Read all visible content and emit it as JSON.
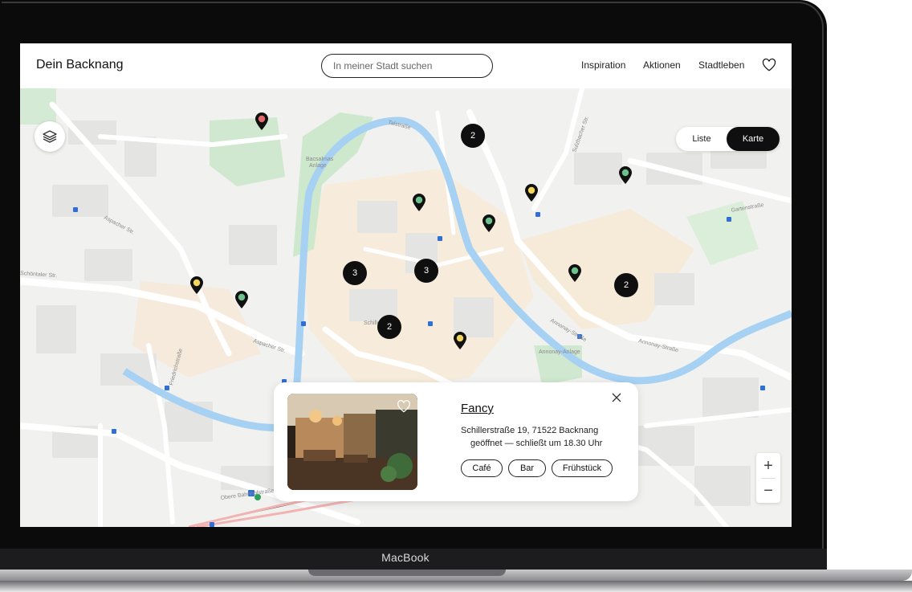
{
  "device": {
    "brand_label": "MacBook"
  },
  "header": {
    "logo": "Dein Backnang",
    "search": {
      "placeholder": "In meiner Stadt suchen"
    },
    "nav": [
      {
        "label": "Inspiration"
      },
      {
        "label": "Aktionen"
      },
      {
        "label": "Stadtleben"
      }
    ],
    "favorites_icon": "heart-icon"
  },
  "view_toggle": {
    "options": [
      "Liste",
      "Karte"
    ],
    "selected": "Karte"
  },
  "map": {
    "layers_icon": "layers-icon",
    "clusters": [
      {
        "count": "2"
      },
      {
        "count": "3"
      },
      {
        "count": "3"
      },
      {
        "count": "2"
      },
      {
        "count": "2"
      }
    ],
    "pin_colors": {
      "red": "#e26b6b",
      "green": "#6cc28d",
      "yellow": "#f2d55a"
    },
    "street_labels": [
      "Talstraße",
      "Aspacher Str.",
      "Schillerstraße",
      "Annonay-Straße",
      "Sulzbacher Str.",
      "Friedrichstraße",
      "Obere Bahnhofstraße",
      "Gartenstraße",
      "Bacsalmas Anlage",
      "Annonay-Anlage",
      "Schöntaler Str."
    ],
    "zoom": {
      "in": "+",
      "out": "−"
    }
  },
  "card": {
    "title": "Fancy",
    "address": "Schillerstraße 19, 71522 Backnang",
    "status": "geöffnet — schließt um 18.30 Uhr",
    "tags": [
      "Café",
      "Bar",
      "Frühstück"
    ],
    "close_icon": "close-icon",
    "favorite_icon": "heart-icon"
  }
}
